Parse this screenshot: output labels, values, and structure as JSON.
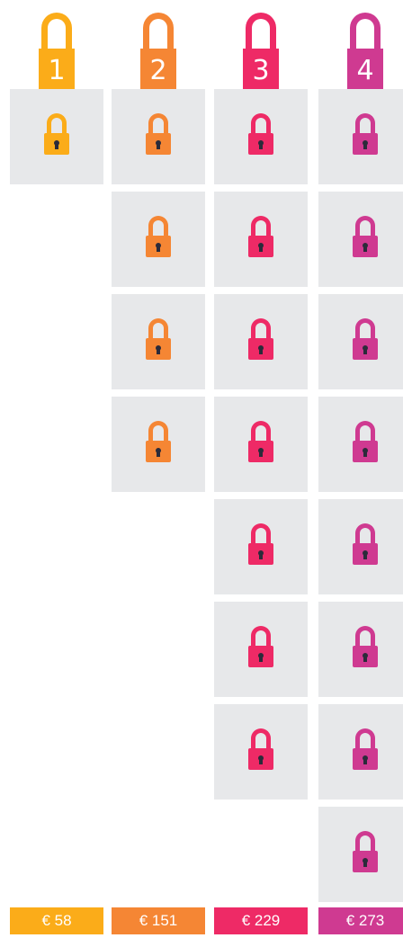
{
  "colors": {
    "tier1": "#fbac19",
    "tier2": "#f58634",
    "tier3": "#ee2a66",
    "tier4": "#cf3a91",
    "cell_bg": "#e7e8ea",
    "keyhole": "#2b2b3a"
  },
  "tiers": [
    {
      "number": "1",
      "price": "€ 58",
      "lock_count": 1,
      "icon": "padlock-icon"
    },
    {
      "number": "2",
      "price": "€ 151",
      "lock_count": 4,
      "icon": "padlock-icon"
    },
    {
      "number": "3",
      "price": "€ 229",
      "lock_count": 7,
      "icon": "padlock-icon"
    },
    {
      "number": "4",
      "price": "€ 273",
      "lock_count": 8,
      "icon": "padlock-icon"
    }
  ]
}
